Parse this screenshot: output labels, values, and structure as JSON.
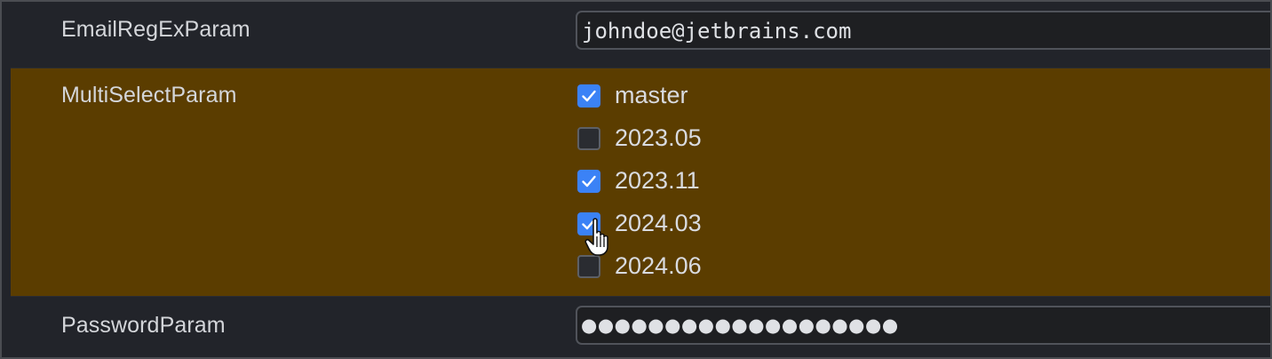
{
  "params": {
    "email": {
      "label": "EmailRegExParam",
      "value": "johndoe@jetbrains.com"
    },
    "multiselect": {
      "label": "MultiSelectParam",
      "options": [
        {
          "label": "master",
          "checked": true
        },
        {
          "label": "2023.05",
          "checked": false
        },
        {
          "label": "2023.11",
          "checked": true
        },
        {
          "label": "2024.03",
          "checked": true
        },
        {
          "label": "2024.06",
          "checked": false
        }
      ],
      "highlight_color": "#5b3d00"
    },
    "password": {
      "label": "PasswordParam",
      "masked_value": "●●●●●●●●●●●●●●●●●●●"
    }
  },
  "icons": {
    "checkmark": "checkmark-icon",
    "cursor": "hand-pointer-icon"
  },
  "colors": {
    "checkbox_checked": "#3b82f6",
    "background": "#22242a"
  }
}
